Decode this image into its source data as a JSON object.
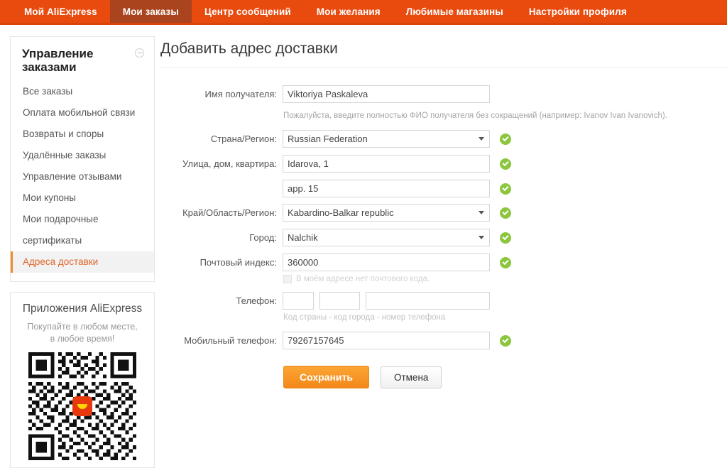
{
  "topnav": {
    "items": [
      {
        "label": "Мой AliExpress",
        "active": false
      },
      {
        "label": "Мои заказы",
        "active": true
      },
      {
        "label": "Центр сообщений",
        "active": false
      },
      {
        "label": "Мои желания",
        "active": false
      },
      {
        "label": "Любимые магазины",
        "active": false
      },
      {
        "label": "Настройки профиля",
        "active": false
      }
    ],
    "bg_color": "#e94a0e",
    "active_bg_color": "#a9441f"
  },
  "sidebar": {
    "title": "Управление заказами",
    "collapse_icon": "circle-minus-icon",
    "items": [
      {
        "label": "Все заказы",
        "active": false
      },
      {
        "label": "Оплата мобильной связи",
        "active": false
      },
      {
        "label": "Возвраты и споры",
        "active": false
      },
      {
        "label": "Удалённые заказы",
        "active": false
      },
      {
        "label": "Управление отзывами",
        "active": false
      },
      {
        "label": "Мои купоны",
        "active": false
      },
      {
        "label": "Мои подарочные",
        "active": false
      },
      {
        "label": "сертификаты",
        "active": false
      },
      {
        "label": "Адреса доставки",
        "active": true
      }
    ],
    "active_color": "#e2662a"
  },
  "promo": {
    "title": "Приложения AliExpress",
    "subtitle": "Покупайте в любом месте, в любое время!",
    "qr_icon": "qr-code",
    "logo_icon": "aliexpress-logo-icon"
  },
  "main": {
    "page_title": "Добавить адрес доставки",
    "fields": {
      "recipient": {
        "label": "Имя получателя:",
        "value": "Viktoriya Paskaleva",
        "hint": "Пожалуйста, введите полностью ФИО получателя без сокращений (например: Ivanov Ivan Ivanovich).",
        "valid": true
      },
      "country": {
        "label": "Страна/Регион:",
        "value": "Russian Federation",
        "valid": true
      },
      "street": {
        "label": "Улица, дом, квартира:",
        "value": "Idarova, 1",
        "valid": true
      },
      "street2": {
        "label": "",
        "value": "app. 15",
        "valid": true
      },
      "region": {
        "label": "Край/Область/Регион:",
        "value": "Kabardino-Balkar republic",
        "valid": true
      },
      "city": {
        "label": "Город:",
        "value": "Nalchik",
        "valid": true
      },
      "zip": {
        "label": "Почтовый индекс:",
        "value": "360000",
        "valid": true,
        "no_zip_checkbox_label": "В моём адресе нет почтового кода.",
        "no_zip_checked": false
      },
      "phone": {
        "label": "Телефон:",
        "country_code": "",
        "area_code": "",
        "number": "",
        "hint": "Код страны - код города - номер телефона"
      },
      "mobile": {
        "label": "Мобильный телефон:",
        "value": "79267157645",
        "valid": true
      }
    },
    "buttons": {
      "save": "Сохранить",
      "cancel": "Отмена"
    },
    "valid_icon": "check-circle-icon",
    "dropdown_icon": "chevron-down-icon"
  }
}
